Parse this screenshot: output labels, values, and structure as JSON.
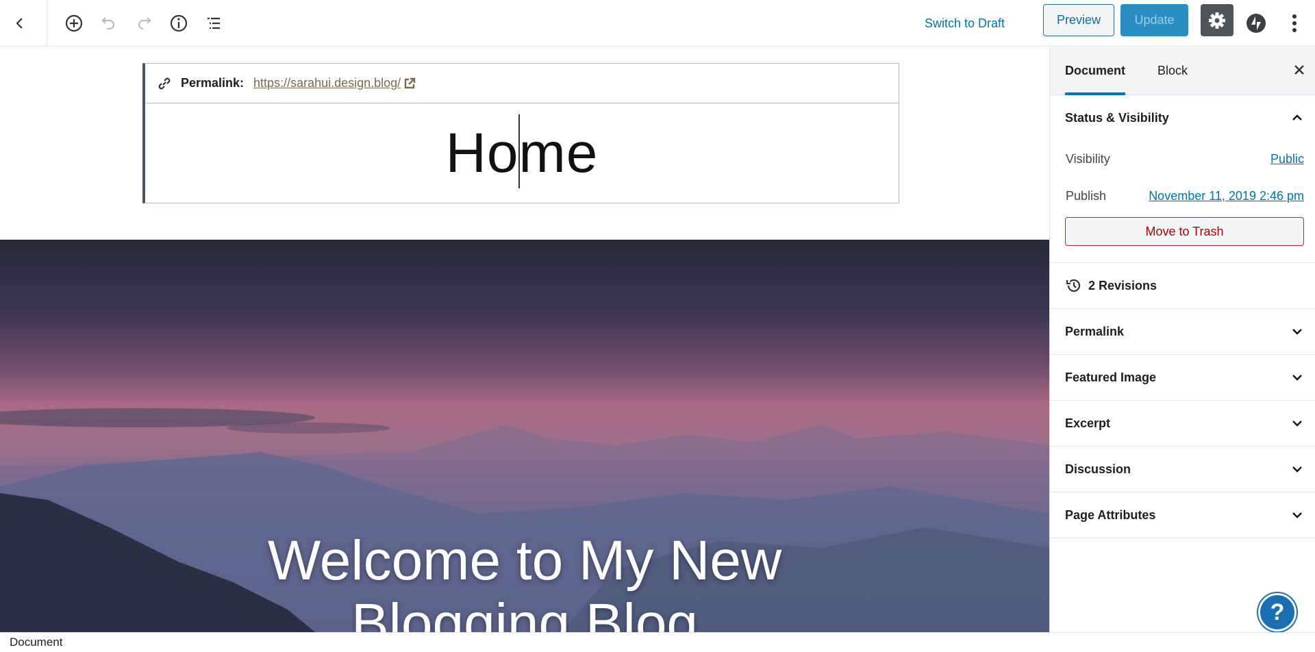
{
  "toolbar": {
    "back_icon": "chevron-left-icon",
    "add_block_icon": "plus-circle-icon",
    "undo_icon": "undo-icon",
    "redo_icon": "redo-icon",
    "info_icon": "info-icon",
    "outline_icon": "list-icon",
    "switch_to_draft": "Switch to Draft",
    "preview": "Preview",
    "update": "Update",
    "settings_icon": "gear-icon",
    "jetpack_icon": "bolt-icon",
    "more_icon": "kebab-icon"
  },
  "editor": {
    "permalink_label": "Permalink:",
    "permalink_url": "https://sarahui.design.blog/",
    "title": "Home",
    "cover_line1": "Welcome to My New",
    "cover_line2": "Blogging Blog"
  },
  "sidebar": {
    "tabs": [
      {
        "label": "Document",
        "active": true
      },
      {
        "label": "Block",
        "active": false
      }
    ],
    "status_heading": "Status & Visibility",
    "visibility_label": "Visibility",
    "visibility_value": "Public",
    "publish_label": "Publish",
    "publish_value": "November 11, 2019 2:46 pm",
    "trash": "Move to Trash",
    "revisions": "2 Revisions",
    "panels": [
      "Permalink",
      "Featured Image",
      "Excerpt",
      "Discussion",
      "Page Attributes"
    ]
  },
  "footer": {
    "breadcrumb": "Document"
  },
  "colors": {
    "accent": "#0073aa",
    "update_button": "#2b8ec3",
    "trash": "#a00"
  }
}
